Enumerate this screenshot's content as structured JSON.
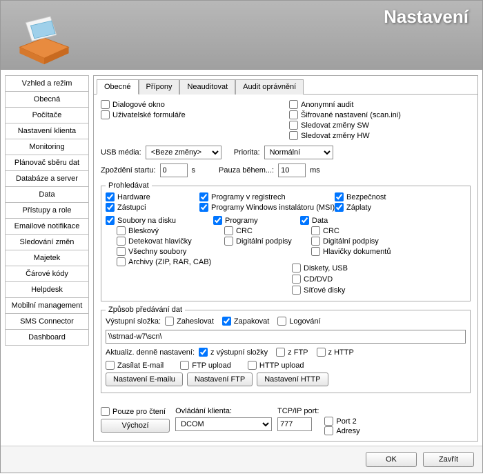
{
  "title": "Nastavení",
  "sidebar": {
    "items": [
      "Vzhled a režim",
      "Obecná",
      "Počítače",
      "Nastavení klienta",
      "Monitoring",
      "Plánovač sběru dat",
      "Databáze a server",
      "Data",
      "Přístupy a role",
      "Emailové notifikace",
      "Sledování změn",
      "Majetek",
      "Čárové kódy",
      "Helpdesk",
      "Mobilní management",
      "SMS Connector",
      "Dashboard"
    ]
  },
  "tabs": [
    "Obecné",
    "Přípony",
    "Neauditovat",
    "Audit oprávnění"
  ],
  "checks": {
    "dialog": "Dialogové okno",
    "userforms": "Uživatelské formuláře",
    "anonaudit": "Anonymní audit",
    "encset": "Šifrované nastavení (scan.ini)",
    "watchsw": "Sledovat změny SW",
    "watchhw": "Sledovat změny HW"
  },
  "usb": {
    "label": "USB média:",
    "value": "<Beze změny>"
  },
  "priority": {
    "label": "Priorita:",
    "value": "Normální"
  },
  "delay": {
    "label": "Zpoždění startu:",
    "value": "0",
    "unit": "s"
  },
  "pause": {
    "label": "Pauza během...:",
    "value": "10",
    "unit": "ms"
  },
  "scan": {
    "legend": "Prohledávat",
    "hardware": "Hardware",
    "shortcuts": "Zástupci",
    "regprog": "Programy v registrech",
    "msi": "Programy Windows instalátoru (MSI)",
    "security": "Bezpečnost",
    "patches": "Záplaty",
    "diskfiles": "Soubory na disku",
    "flash": "Bleskový",
    "detecthdr": "Detekovat hlavičky",
    "allfiles": "Všechny soubory",
    "archives": "Archivy (ZIP, RAR, CAB)",
    "programs": "Programy",
    "crc1": "CRC",
    "digsig1": "Digitální podpisy",
    "data": "Data",
    "crc2": "CRC",
    "digsig2": "Digitální podpisy",
    "dochdr": "Hlavičky dokumentů",
    "floppy": "Diskety, USB",
    "cddvd": "CD/DVD",
    "netdisk": "Síťové disky"
  },
  "transfer": {
    "legend": "Způsob předávání dat",
    "outlabel": "Výstupní složka:",
    "password": "Zaheslovat",
    "pack": "Zapakovat",
    "logging": "Logování",
    "path": "\\\\strnad-w7\\scn\\",
    "updlabel": "Aktualiz. denně nastavení:",
    "fromout": "z výstupní složky",
    "fromftp": "z FTP",
    "fromhttp": "z HTTP",
    "sendmail": "Zasílat E-mail",
    "ftpup": "FTP upload",
    "httpup": "HTTP upload",
    "btnmail": "Nastavení E-mailu",
    "btnftp": "Nastavení FTP",
    "btnhttp": "Nastavení HTTP"
  },
  "footer": {
    "readonly": "Pouze pro čtení",
    "defaults": "Výchozí",
    "clientctrl": "Ovládání klienta:",
    "clientval": "DCOM",
    "tcplabel": "TCP/IP port:",
    "tcpval": "777",
    "port2": "Port 2",
    "addresses": "Adresy"
  },
  "buttons": {
    "ok": "OK",
    "close": "Zavřít"
  }
}
